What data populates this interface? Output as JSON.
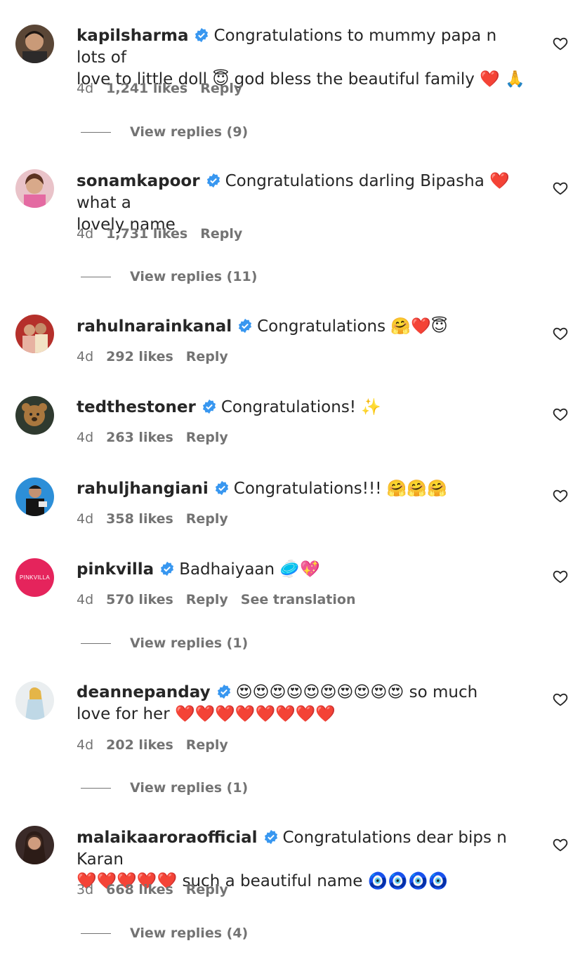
{
  "colors": {
    "text": "#262626",
    "secondary": "#737373",
    "verified": "#3897f0",
    "pinkvilla": "#e5245c"
  },
  "comments": [
    {
      "username": "kapilsharma",
      "verified": true,
      "line1": "Congratulations to mummy papa n lots of",
      "line2": "love to little doll 😇 god bless the beautiful family ❤️ 🙏",
      "time": "4d",
      "likes": "1,241 likes",
      "reply": "Reply",
      "view_replies": "View replies (9)"
    },
    {
      "username": "sonamkapoor",
      "verified": true,
      "line1": "Congratulations darling Bipasha ❤️what a",
      "line2": "lovely name",
      "time": "4d",
      "likes": "1,731 likes",
      "reply": "Reply",
      "view_replies": "View replies (11)"
    },
    {
      "username": "rahulnarainkanal",
      "verified": true,
      "line1": "Congratulations 🤗❤️😇",
      "time": "4d",
      "likes": "292 likes",
      "reply": "Reply"
    },
    {
      "username": "tedthestoner",
      "verified": true,
      "line1": "Congratulations! ✨",
      "time": "4d",
      "likes": "263 likes",
      "reply": "Reply"
    },
    {
      "username": "rahuljhangiani",
      "verified": true,
      "line1": "Congratulations!!! 🤗🤗🤗",
      "time": "4d",
      "likes": "358 likes",
      "reply": "Reply"
    },
    {
      "username": "pinkvilla",
      "verified": true,
      "avatar_text": "PINKVILLA",
      "line1": "Badhaiyaan 🥏💖",
      "time": "4d",
      "likes": "570 likes",
      "reply": "Reply",
      "translate": "See translation",
      "view_replies": "View replies (1)"
    },
    {
      "username": "deannepanday",
      "verified": true,
      "line1": "😍😍😍😍😍😍😍😍😍😍 so much",
      "line2": "love for her ❤️❤️❤️❤️❤️❤️❤️❤️",
      "time": "4d",
      "likes": "202 likes",
      "reply": "Reply",
      "view_replies": "View replies (1)"
    },
    {
      "username": "malaikaaroraofficial",
      "verified": true,
      "line1": "Congratulations dear bips n Karan",
      "line2": "❤️❤️❤️❤️❤️ such a beautiful name 🧿🧿🧿🧿",
      "time": "3d",
      "likes": "668 likes",
      "reply": "Reply",
      "view_replies": "View replies (4)"
    }
  ]
}
